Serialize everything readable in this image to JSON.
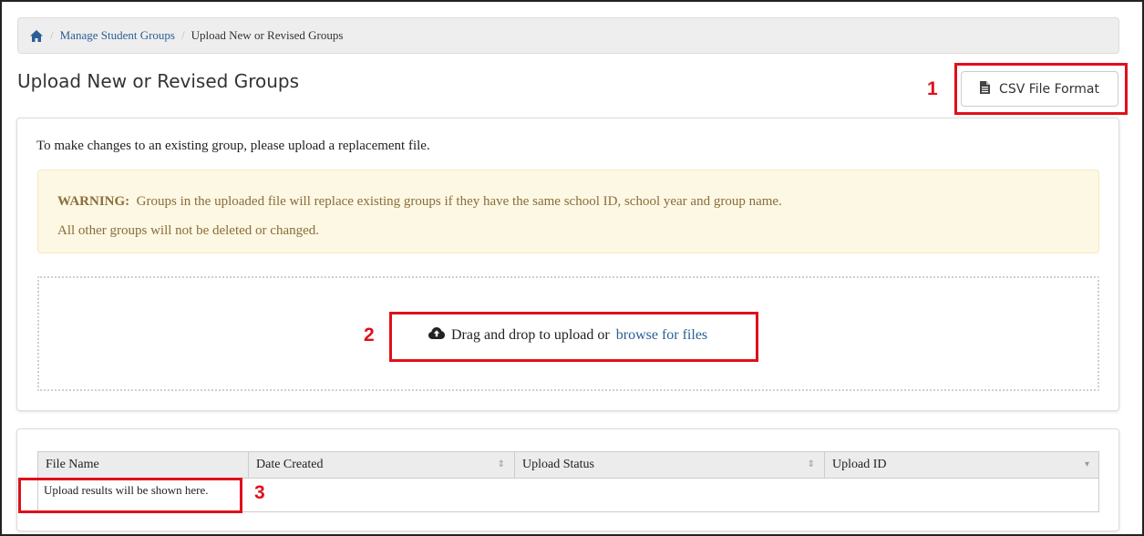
{
  "breadcrumb": {
    "home_icon": "home-icon",
    "items": [
      "Manage Student Groups"
    ],
    "current": "Upload New or Revised Groups"
  },
  "page": {
    "title": "Upload New or Revised Groups",
    "csv_button_label": "CSV File Format",
    "csv_button_icon": "file-text-icon"
  },
  "panel": {
    "intro_text": "To make changes to an existing group, please upload a replacement file.",
    "warning_label": "WARNING:",
    "warning_line1": "Groups in the uploaded file will replace existing groups if they have the same school ID, school year and group name.",
    "warning_line2": "All other groups will not be deleted or changed.",
    "drop_icon": "cloud-upload-icon",
    "drop_text": "Drag and drop to upload or",
    "browse_link": "browse for files"
  },
  "table": {
    "columns": [
      "File Name",
      "Date Created",
      "Upload Status",
      "Upload ID"
    ],
    "empty_message": "Upload results will be shown here."
  },
  "annotations": [
    "1",
    "2",
    "3"
  ],
  "colors": {
    "link": "#2a5f95",
    "annotation": "#e0101a",
    "warning_bg": "#fcf8e3",
    "warning_text": "#8a6d3b"
  }
}
